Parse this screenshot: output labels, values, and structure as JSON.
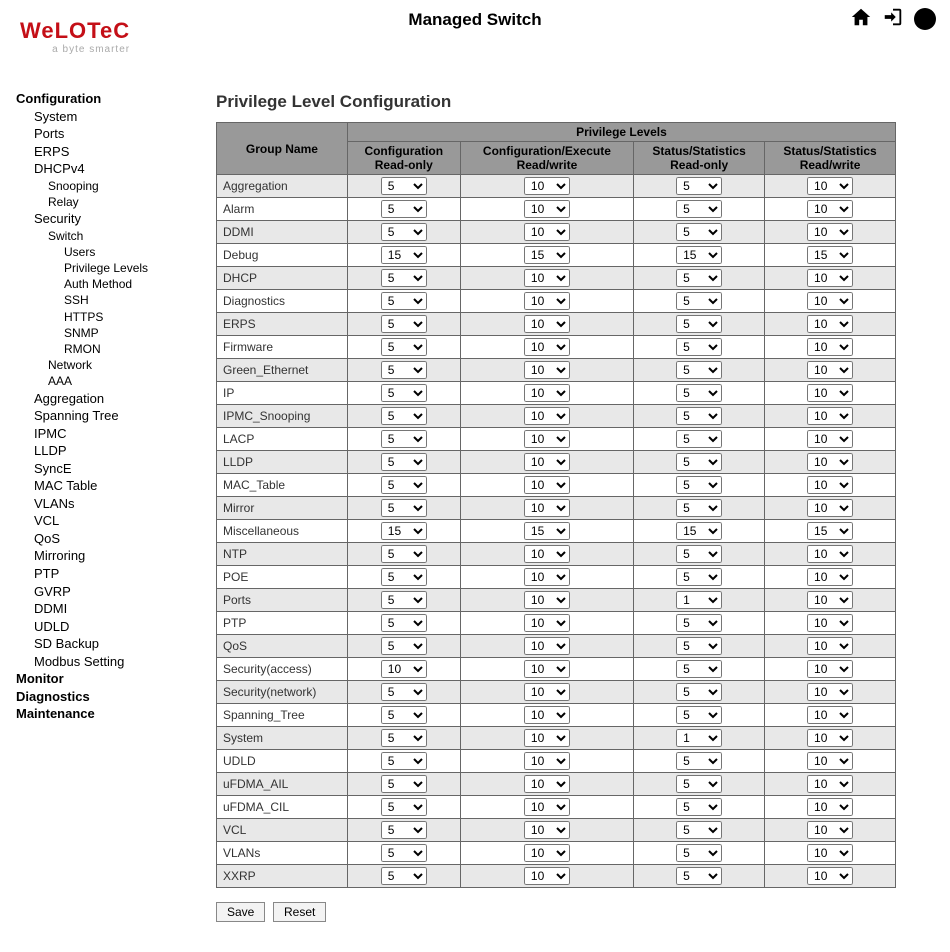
{
  "header": {
    "title": "Managed Switch",
    "logo_text": "WeLOTeC",
    "logo_tag": "a byte smarter"
  },
  "sidebar": [
    {
      "label": "Configuration",
      "cls": "nav-top"
    },
    {
      "label": "System",
      "cls": "nav-l1"
    },
    {
      "label": "Ports",
      "cls": "nav-l1"
    },
    {
      "label": "ERPS",
      "cls": "nav-l1"
    },
    {
      "label": "DHCPv4",
      "cls": "nav-l1"
    },
    {
      "label": "Snooping",
      "cls": "nav-l2"
    },
    {
      "label": "Relay",
      "cls": "nav-l2"
    },
    {
      "label": "Security",
      "cls": "nav-l1"
    },
    {
      "label": "Switch",
      "cls": "nav-l2"
    },
    {
      "label": "Users",
      "cls": "nav-l3"
    },
    {
      "label": "Privilege Levels",
      "cls": "nav-l3"
    },
    {
      "label": "Auth Method",
      "cls": "nav-l3"
    },
    {
      "label": "SSH",
      "cls": "nav-l3"
    },
    {
      "label": "HTTPS",
      "cls": "nav-l3"
    },
    {
      "label": "SNMP",
      "cls": "nav-l3"
    },
    {
      "label": "RMON",
      "cls": "nav-l3"
    },
    {
      "label": "Network",
      "cls": "nav-l2"
    },
    {
      "label": "AAA",
      "cls": "nav-l2"
    },
    {
      "label": "Aggregation",
      "cls": "nav-l1"
    },
    {
      "label": "Spanning Tree",
      "cls": "nav-l1"
    },
    {
      "label": "IPMC",
      "cls": "nav-l1"
    },
    {
      "label": "LLDP",
      "cls": "nav-l1"
    },
    {
      "label": "SyncE",
      "cls": "nav-l1"
    },
    {
      "label": "MAC Table",
      "cls": "nav-l1"
    },
    {
      "label": "VLANs",
      "cls": "nav-l1"
    },
    {
      "label": "VCL",
      "cls": "nav-l1"
    },
    {
      "label": "QoS",
      "cls": "nav-l1"
    },
    {
      "label": "Mirroring",
      "cls": "nav-l1"
    },
    {
      "label": "PTP",
      "cls": "nav-l1"
    },
    {
      "label": "GVRP",
      "cls": "nav-l1"
    },
    {
      "label": "DDMI",
      "cls": "nav-l1"
    },
    {
      "label": "UDLD",
      "cls": "nav-l1"
    },
    {
      "label": "SD Backup",
      "cls": "nav-l1"
    },
    {
      "label": "Modbus Setting",
      "cls": "nav-l1"
    },
    {
      "label": "Monitor",
      "cls": "nav-top"
    },
    {
      "label": "Diagnostics",
      "cls": "nav-top"
    },
    {
      "label": "Maintenance",
      "cls": "nav-top"
    }
  ],
  "page": {
    "title": "Privilege Level Configuration",
    "col_group": "Group Name",
    "col_super": "Privilege Levels",
    "cols": [
      "Configuration\nRead-only",
      "Configuration/Execute\nRead/write",
      "Status/Statistics\nRead-only",
      "Status/Statistics\nRead/write"
    ],
    "save_label": "Save",
    "reset_label": "Reset"
  },
  "rows": [
    {
      "name": "Aggregation",
      "v": [
        "5",
        "10",
        "5",
        "10"
      ]
    },
    {
      "name": "Alarm",
      "v": [
        "5",
        "10",
        "5",
        "10"
      ]
    },
    {
      "name": "DDMI",
      "v": [
        "5",
        "10",
        "5",
        "10"
      ]
    },
    {
      "name": "Debug",
      "v": [
        "15",
        "15",
        "15",
        "15"
      ]
    },
    {
      "name": "DHCP",
      "v": [
        "5",
        "10",
        "5",
        "10"
      ]
    },
    {
      "name": "Diagnostics",
      "v": [
        "5",
        "10",
        "5",
        "10"
      ]
    },
    {
      "name": "ERPS",
      "v": [
        "5",
        "10",
        "5",
        "10"
      ]
    },
    {
      "name": "Firmware",
      "v": [
        "5",
        "10",
        "5",
        "10"
      ]
    },
    {
      "name": "Green_Ethernet",
      "v": [
        "5",
        "10",
        "5",
        "10"
      ]
    },
    {
      "name": "IP",
      "v": [
        "5",
        "10",
        "5",
        "10"
      ]
    },
    {
      "name": "IPMC_Snooping",
      "v": [
        "5",
        "10",
        "5",
        "10"
      ]
    },
    {
      "name": "LACP",
      "v": [
        "5",
        "10",
        "5",
        "10"
      ]
    },
    {
      "name": "LLDP",
      "v": [
        "5",
        "10",
        "5",
        "10"
      ]
    },
    {
      "name": "MAC_Table",
      "v": [
        "5",
        "10",
        "5",
        "10"
      ]
    },
    {
      "name": "Mirror",
      "v": [
        "5",
        "10",
        "5",
        "10"
      ]
    },
    {
      "name": "Miscellaneous",
      "v": [
        "15",
        "15",
        "15",
        "15"
      ]
    },
    {
      "name": "NTP",
      "v": [
        "5",
        "10",
        "5",
        "10"
      ]
    },
    {
      "name": "POE",
      "v": [
        "5",
        "10",
        "5",
        "10"
      ]
    },
    {
      "name": "Ports",
      "v": [
        "5",
        "10",
        "1",
        "10"
      ]
    },
    {
      "name": "PTP",
      "v": [
        "5",
        "10",
        "5",
        "10"
      ]
    },
    {
      "name": "QoS",
      "v": [
        "5",
        "10",
        "5",
        "10"
      ]
    },
    {
      "name": "Security(access)",
      "v": [
        "10",
        "10",
        "5",
        "10"
      ]
    },
    {
      "name": "Security(network)",
      "v": [
        "5",
        "10",
        "5",
        "10"
      ]
    },
    {
      "name": "Spanning_Tree",
      "v": [
        "5",
        "10",
        "5",
        "10"
      ]
    },
    {
      "name": "System",
      "v": [
        "5",
        "10",
        "1",
        "10"
      ]
    },
    {
      "name": "UDLD",
      "v": [
        "5",
        "10",
        "5",
        "10"
      ]
    },
    {
      "name": "uFDMA_AIL",
      "v": [
        "5",
        "10",
        "5",
        "10"
      ]
    },
    {
      "name": "uFDMA_CIL",
      "v": [
        "5",
        "10",
        "5",
        "10"
      ]
    },
    {
      "name": "VCL",
      "v": [
        "5",
        "10",
        "5",
        "10"
      ]
    },
    {
      "name": "VLANs",
      "v": [
        "5",
        "10",
        "5",
        "10"
      ]
    },
    {
      "name": "XXRP",
      "v": [
        "5",
        "10",
        "5",
        "10"
      ]
    }
  ]
}
